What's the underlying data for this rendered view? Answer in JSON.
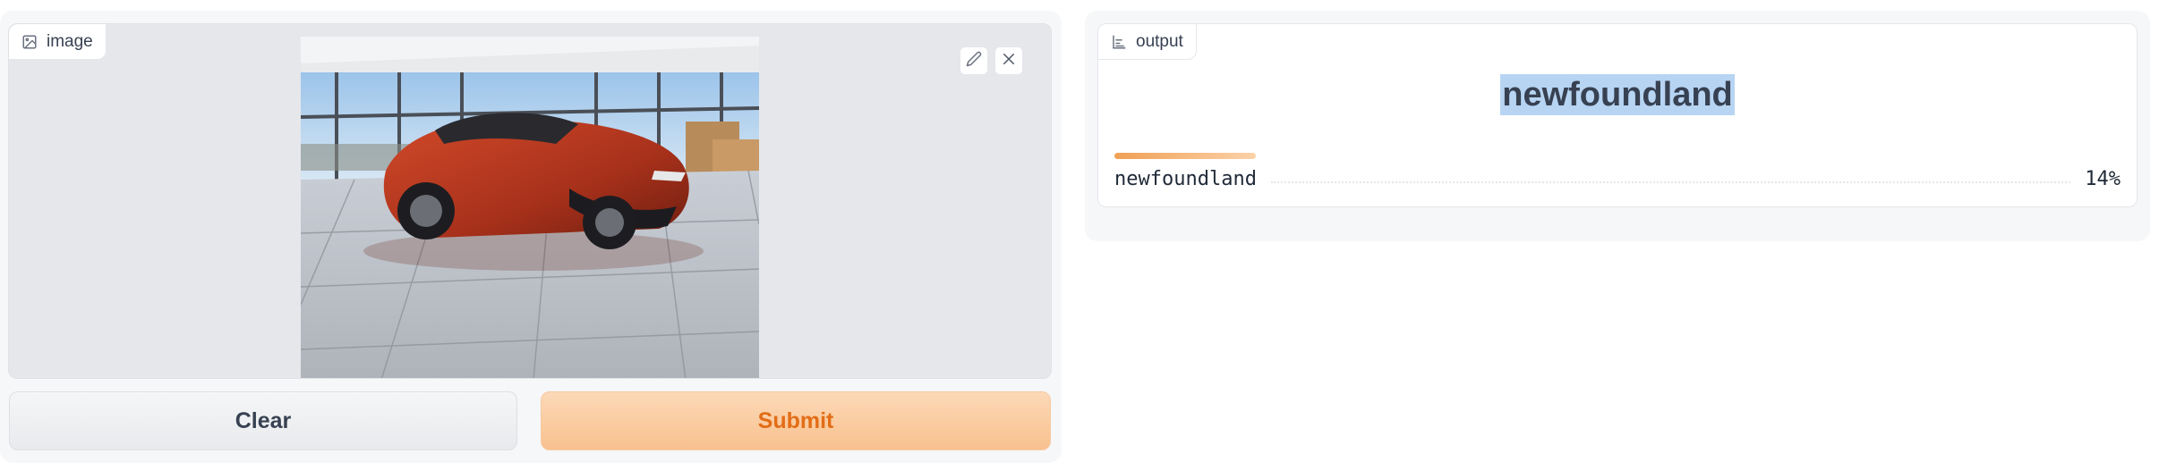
{
  "input": {
    "label": "image",
    "label_icon": "image-icon",
    "edit_icon": "pencil-icon",
    "clear_icon": "close-icon"
  },
  "buttons": {
    "clear_label": "Clear",
    "submit_label": "Submit"
  },
  "output": {
    "label": "output",
    "label_icon": "bar-chart-icon",
    "top_label": "newfoundland",
    "confidences": [
      {
        "label": "newfoundland",
        "percent": "14%",
        "value": 0.14
      }
    ]
  },
  "colors": {
    "accent": "#f97316",
    "submit_bg": "#fcd3ad",
    "highlight": "#b7d4f3"
  }
}
